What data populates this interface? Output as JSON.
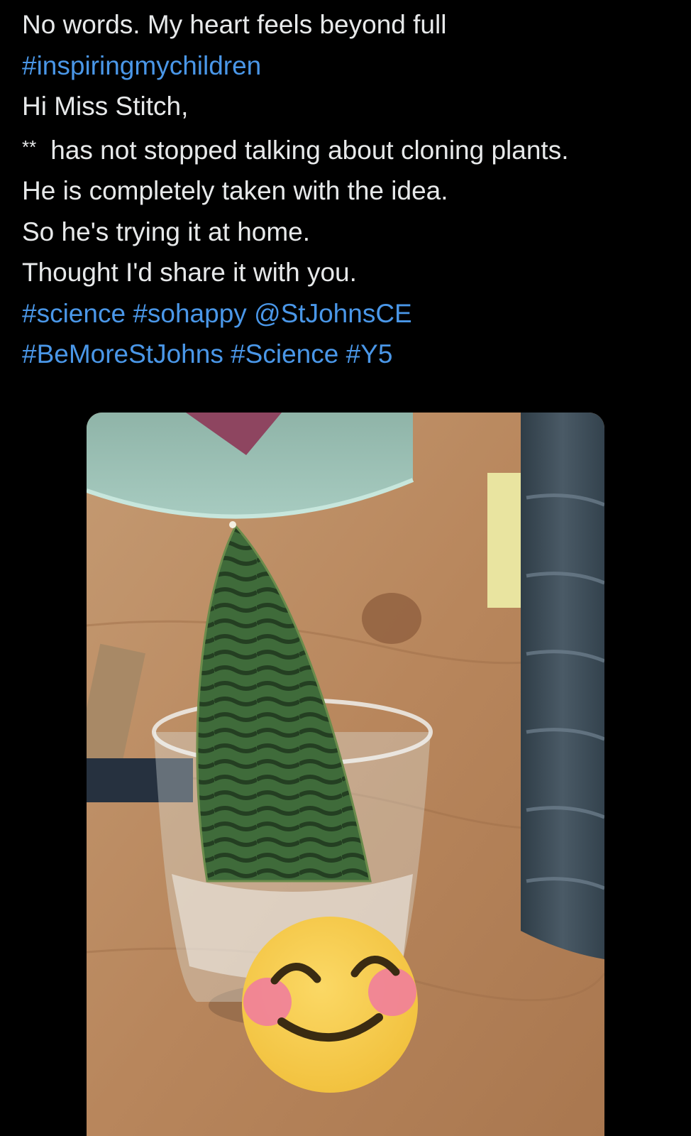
{
  "tweet": {
    "lines": [
      {
        "text": "No words. My heart feels beyond full"
      },
      {
        "links": [
          "#inspiringmychildren"
        ]
      },
      {
        "text": "Hi Miss Stitch,"
      },
      {
        "prefix": "**",
        "text": "has not stopped talking about cloning plants."
      },
      {
        "text": "He is completely taken with the idea."
      },
      {
        "text": "So he's trying it at home."
      },
      {
        "text": "Thought I'd share it with you."
      },
      {
        "links": [
          "#science",
          "#sohappy",
          "@StJohnsCE"
        ]
      },
      {
        "links": [
          "#BeMoreStJohns",
          "#Science",
          "#Y5"
        ]
      }
    ]
  },
  "media": {
    "subject": "snake plant leaf cutting in a glass of water on a wooden table",
    "overlay_icon": "smiling-face-with-blushing-cheeks-emoji"
  },
  "colors": {
    "background": "#000000",
    "text": "#e7e9ea",
    "link": "#4a97e8"
  }
}
